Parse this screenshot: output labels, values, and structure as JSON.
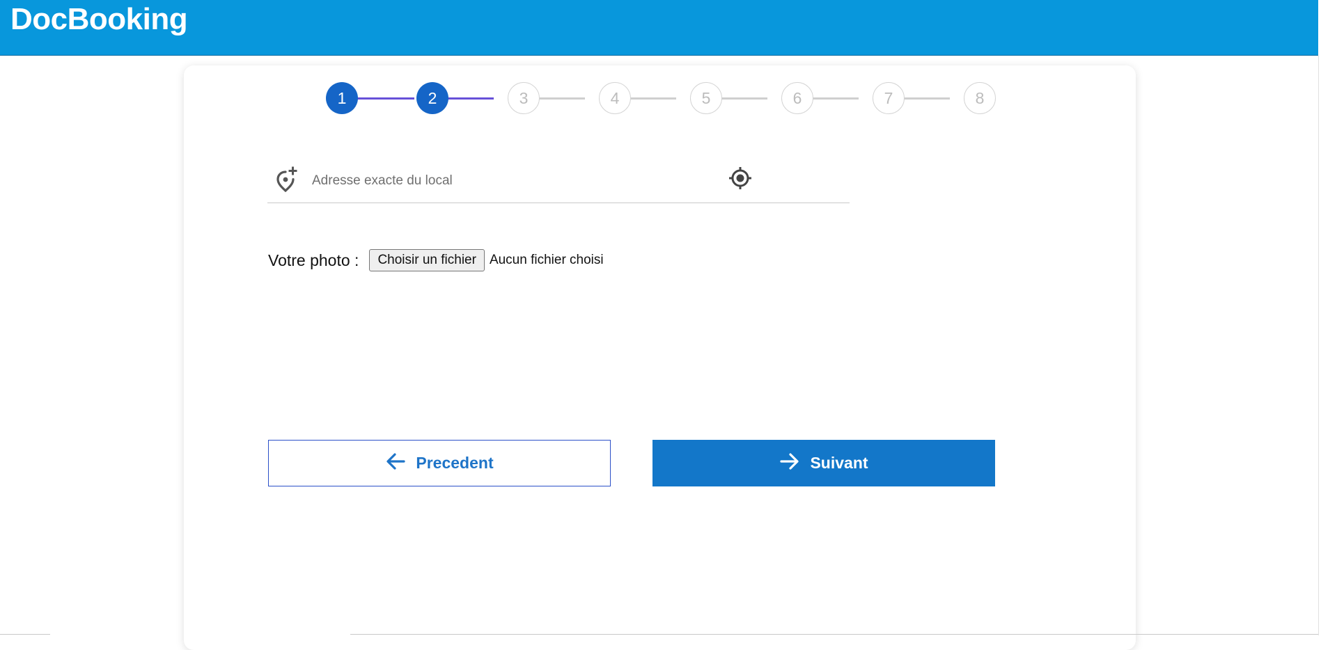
{
  "header": {
    "brand": "DocBooking"
  },
  "stepper": {
    "steps": [
      {
        "label": "1",
        "state": "active"
      },
      {
        "label": "2",
        "state": "active"
      },
      {
        "label": "3",
        "state": "inactive"
      },
      {
        "label": "4",
        "state": "inactive"
      },
      {
        "label": "5",
        "state": "inactive"
      },
      {
        "label": "6",
        "state": "inactive"
      },
      {
        "label": "7",
        "state": "inactive"
      },
      {
        "label": "8",
        "state": "inactive"
      }
    ],
    "current_step": 2,
    "total_steps": 8
  },
  "address": {
    "placeholder": "Adresse exacte du local",
    "value": "",
    "leading_icon": "add-location-icon",
    "trailing_icon": "my-location-icon"
  },
  "photo": {
    "label": "Votre photo :",
    "button_label": "Choisir un fichier",
    "status": "Aucun fichier choisi"
  },
  "navigation": {
    "prev_label": "Precedent",
    "prev_icon": "arrow-left-icon",
    "next_label": "Suivant",
    "next_icon": "arrow-right-icon"
  },
  "colors": {
    "header_bg": "#0897dc",
    "step_active": "#1565c7",
    "step_line_done": "#6650d8",
    "step_inactive_border": "#d4d4d4",
    "button_primary": "#1377c9",
    "button_outline_border": "#2b4fc8",
    "button_outline_text": "#1e74c8"
  }
}
